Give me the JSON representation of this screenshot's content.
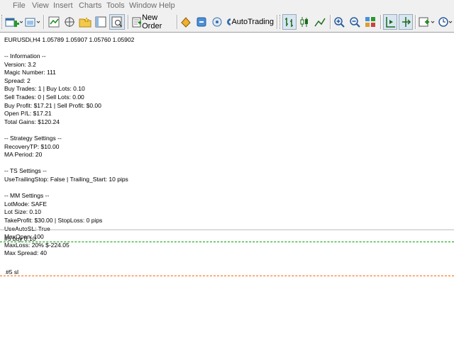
{
  "menu": [
    "File",
    "View",
    "Insert",
    "Charts",
    "Tools",
    "Window",
    "Help"
  ],
  "toolbar": {
    "new_order_label": "New Order",
    "autotrading_label": "AutoTrading"
  },
  "chart": {
    "header": "EURUSDi,H4  1.05789 1.05907 1.05760 1.05902",
    "info_lines": [
      "-- Information --",
      "Version: 3.2",
      "Magic Number: 111",
      "Spread: 2",
      "Buy Trades: 1 | Buy Lots: 0.10",
      "Sell Trades: 0 | Sell Lots: 0.00",
      "Buy Profit: $17.21 | Sell Profit: $0.00",
      "Open P/L: $17.21",
      "Total Gains: $120.24",
      "",
      "-- Strategy Settings --",
      "RecoveryTP: $10.00",
      "MA Period: 20",
      "",
      "-- TS Settings --",
      "UseTrailingStop: False | Trailing_Start: 10 pips",
      "",
      "-- MM Settings --",
      "LotMode: SAFE",
      "Lot Size: 0.10",
      "TakeProfit: $30.00 | StopLoss: 0 pips",
      "UseAutoSL: True",
      "MaxOpen: 100",
      "MaxLoss: 20%  $-224.05",
      "Max Spread: 40"
    ],
    "buy_line_label": "#5 buy 0.10",
    "sl_line_label": "#5 sl",
    "colors": {
      "buy_line": "#00a000",
      "sl_line": "#ff6000",
      "grid_line": "#c0c0c0"
    }
  }
}
